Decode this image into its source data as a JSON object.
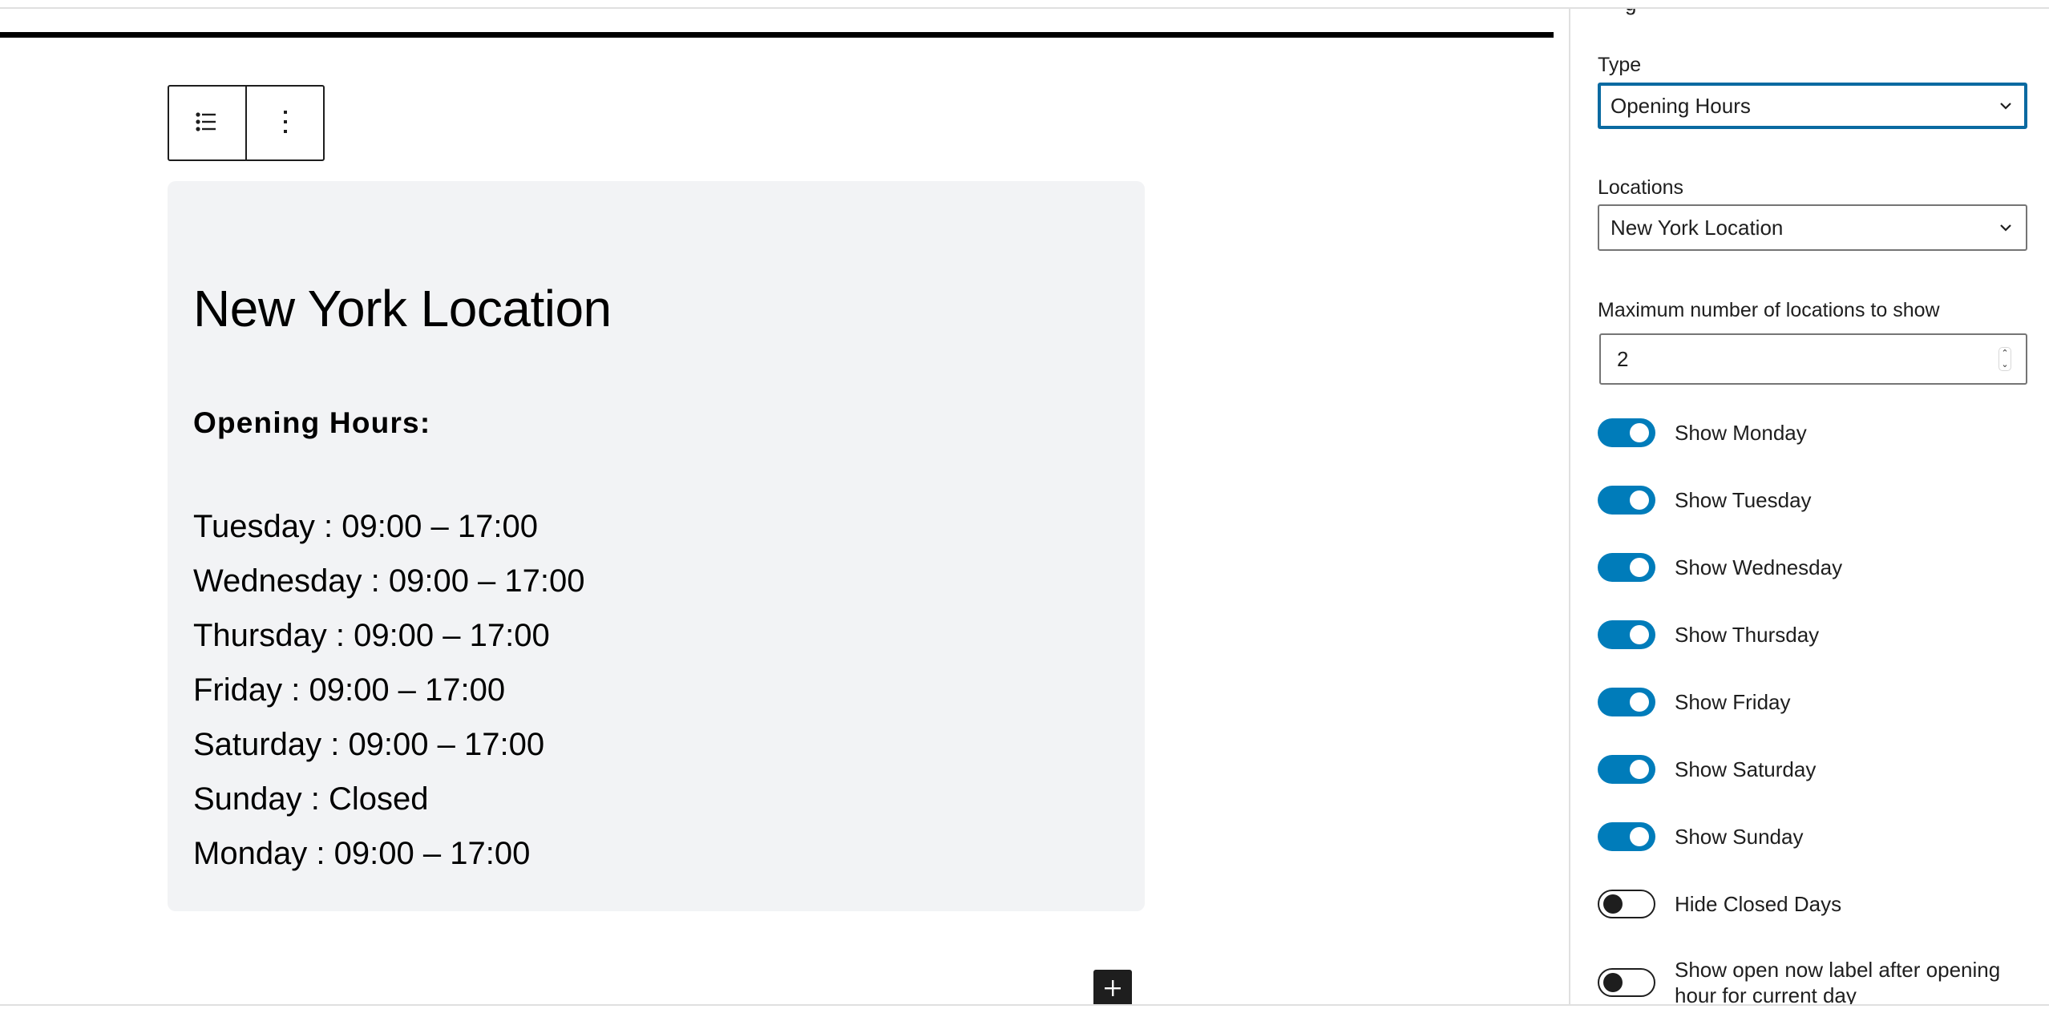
{
  "editor": {
    "toolbar": {
      "list_view_icon": "list-bullets-icon",
      "more_options_icon": "kebab-vertical-icon"
    },
    "block": {
      "location_title": "New York Location",
      "hours_heading": "Opening Hours:",
      "hours": [
        {
          "day": "Tuesday",
          "text": "Tuesday : 09:00 – 17:00"
        },
        {
          "day": "Wednesday",
          "text": "Wednesday : 09:00 – 17:00"
        },
        {
          "day": "Thursday",
          "text": "Thursday : 09:00 – 17:00"
        },
        {
          "day": "Friday",
          "text": "Friday : 09:00 – 17:00"
        },
        {
          "day": "Saturday",
          "text": "Saturday : 09:00 – 17:00"
        },
        {
          "day": "Sunday",
          "text": "Sunday : Closed"
        },
        {
          "day": "Monday",
          "text": "Monday : 09:00 – 17:00"
        }
      ]
    },
    "add_block_icon": "plus-icon"
  },
  "sidebar": {
    "type": {
      "label": "Type",
      "value": "Opening Hours"
    },
    "locations": {
      "label": "Locations",
      "value": "New York Location"
    },
    "max_locations": {
      "label": "Maximum number of locations to show",
      "value": "2"
    },
    "toggles": [
      {
        "label": "Show Monday",
        "checked": true
      },
      {
        "label": "Show Tuesday",
        "checked": true
      },
      {
        "label": "Show Wednesday",
        "checked": true
      },
      {
        "label": "Show Thursday",
        "checked": true
      },
      {
        "label": "Show Friday",
        "checked": true
      },
      {
        "label": "Show Saturday",
        "checked": true
      },
      {
        "label": "Show Sunday",
        "checked": true
      },
      {
        "label": "Hide Closed Days",
        "checked": false
      },
      {
        "label": "Show open now label after opening hour for current day",
        "checked": false
      }
    ]
  },
  "colors": {
    "accent": "#007cba",
    "focus_border": "#0a6aa1",
    "card_background": "#f2f3f5",
    "text": "#1e1e1e"
  }
}
